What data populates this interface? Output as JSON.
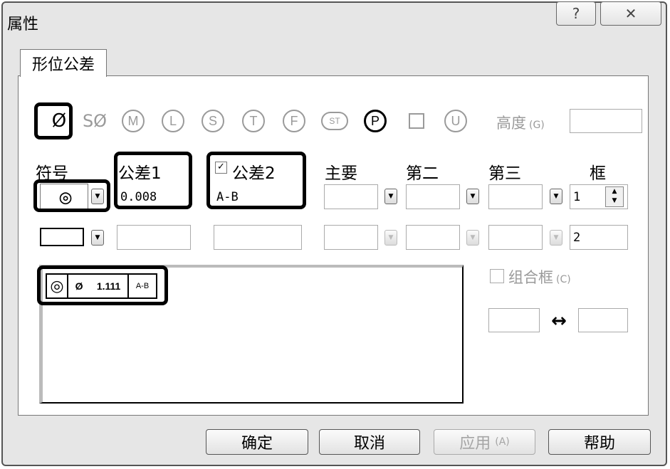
{
  "window": {
    "title": "属性",
    "help_glyph": "?",
    "close_glyph": "✕"
  },
  "tab": {
    "label": "形位公差"
  },
  "symbols_row": {
    "items": [
      {
        "name": "diameter",
        "glyph": "Ø",
        "selected": true
      },
      {
        "name": "spherical-diameter",
        "glyph": "SØ"
      },
      {
        "name": "M",
        "glyph": "M"
      },
      {
        "name": "L",
        "glyph": "L"
      },
      {
        "name": "S",
        "glyph": "S"
      },
      {
        "name": "T",
        "glyph": "T"
      },
      {
        "name": "F",
        "glyph": "F"
      },
      {
        "name": "ST",
        "glyph": "ST"
      },
      {
        "name": "P",
        "glyph": "P"
      },
      {
        "name": "square",
        "glyph": ""
      },
      {
        "name": "U",
        "glyph": "U"
      }
    ],
    "height_label": "高度",
    "height_key": "(G)",
    "height_value": ""
  },
  "headers": {
    "symbol": "符号",
    "tolerance1": "公差1",
    "tolerance2": "公差2",
    "primary": "主要",
    "secondary": "第二",
    "tertiary": "第三",
    "frame": "框"
  },
  "row1": {
    "symbol": "◎",
    "tolerance1": "0.008",
    "tolerance2": "A-B",
    "tolerance2_checked": true,
    "primary": "",
    "secondary": "",
    "tertiary": "",
    "frame": "1"
  },
  "row2": {
    "frame": "2"
  },
  "preview": {
    "symbol": "◎",
    "diameter": "Ø",
    "value": "1.111",
    "datum": "A-B"
  },
  "combo": {
    "label": "组合框",
    "key": "(C)",
    "checked": false,
    "arrow": "↔"
  },
  "buttons": {
    "ok": "确定",
    "cancel": "取消",
    "apply": "应用",
    "apply_key": "(A)",
    "help": "帮助"
  }
}
